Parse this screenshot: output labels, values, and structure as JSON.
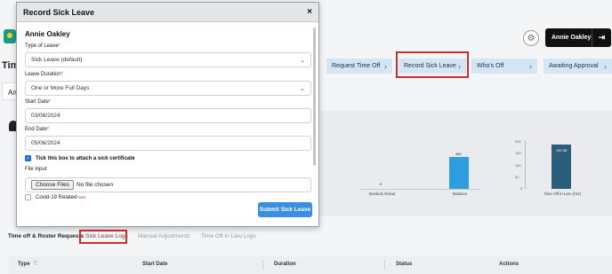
{
  "modal": {
    "title": "Record Sick Leave",
    "close_glyph": "×",
    "employee_name": "Annie Oakley",
    "type_of_leave": {
      "label": "Type of Leave",
      "value": "Sick Leave (default)"
    },
    "leave_duration": {
      "label": "Leave Duration",
      "value": "One or More Full Days"
    },
    "start_date": {
      "label": "Start Date",
      "value": "03/06/2024"
    },
    "end_date": {
      "label": "End Date",
      "value": "05/06/2024"
    },
    "required_marker": "*",
    "sick_certificate": {
      "label": "Tick this box to attach a sick certificate",
      "checked": true
    },
    "file_input": {
      "label": "File input",
      "button": "Choose Files",
      "status": "No file chosen"
    },
    "covid": {
      "label": "Covid-19 Related",
      "tag": "New",
      "checked": false
    },
    "submit_label": "Submit Sick Leave"
  },
  "header": {
    "user_name": "Annie Oakley",
    "page_title_fragment": "Tim",
    "select_fragment": "Ann"
  },
  "action_tabs": [
    {
      "label": "Request Time Off"
    },
    {
      "label": "Record Sick Leave"
    },
    {
      "label": "Who's Off"
    },
    {
      "label": "Awaiting Approval"
    }
  ],
  "chart_data": {
    "type": "bar",
    "categories": [
      "Booked Ahead",
      "Balance",
      "Time Off in Lieu (hrs)"
    ],
    "values": [
      0,
      480,
      190.38
    ],
    "value_labels": [
      "0",
      "480",
      "190.38"
    ],
    "axis_ticks": [
      "200",
      "150",
      "100",
      "50",
      "0"
    ],
    "colors": {
      "balance": "#2d9fe0",
      "lieu": "#2b5e7a"
    }
  },
  "section_tabs": [
    {
      "label": "Time off & Roster Requests"
    },
    {
      "label": "Sick Leave Logs"
    },
    {
      "label": "Manual Adjustments"
    },
    {
      "label": "Time Off In Lieu Logs"
    }
  ],
  "table": {
    "columns": [
      "Type",
      "Start Date",
      "Duration",
      "Status",
      "Actions"
    ]
  },
  "colors": {
    "accent_blue": "#3b8fe0",
    "highlight_red": "#d62b2b",
    "tab_bg": "#d4e6f4"
  }
}
